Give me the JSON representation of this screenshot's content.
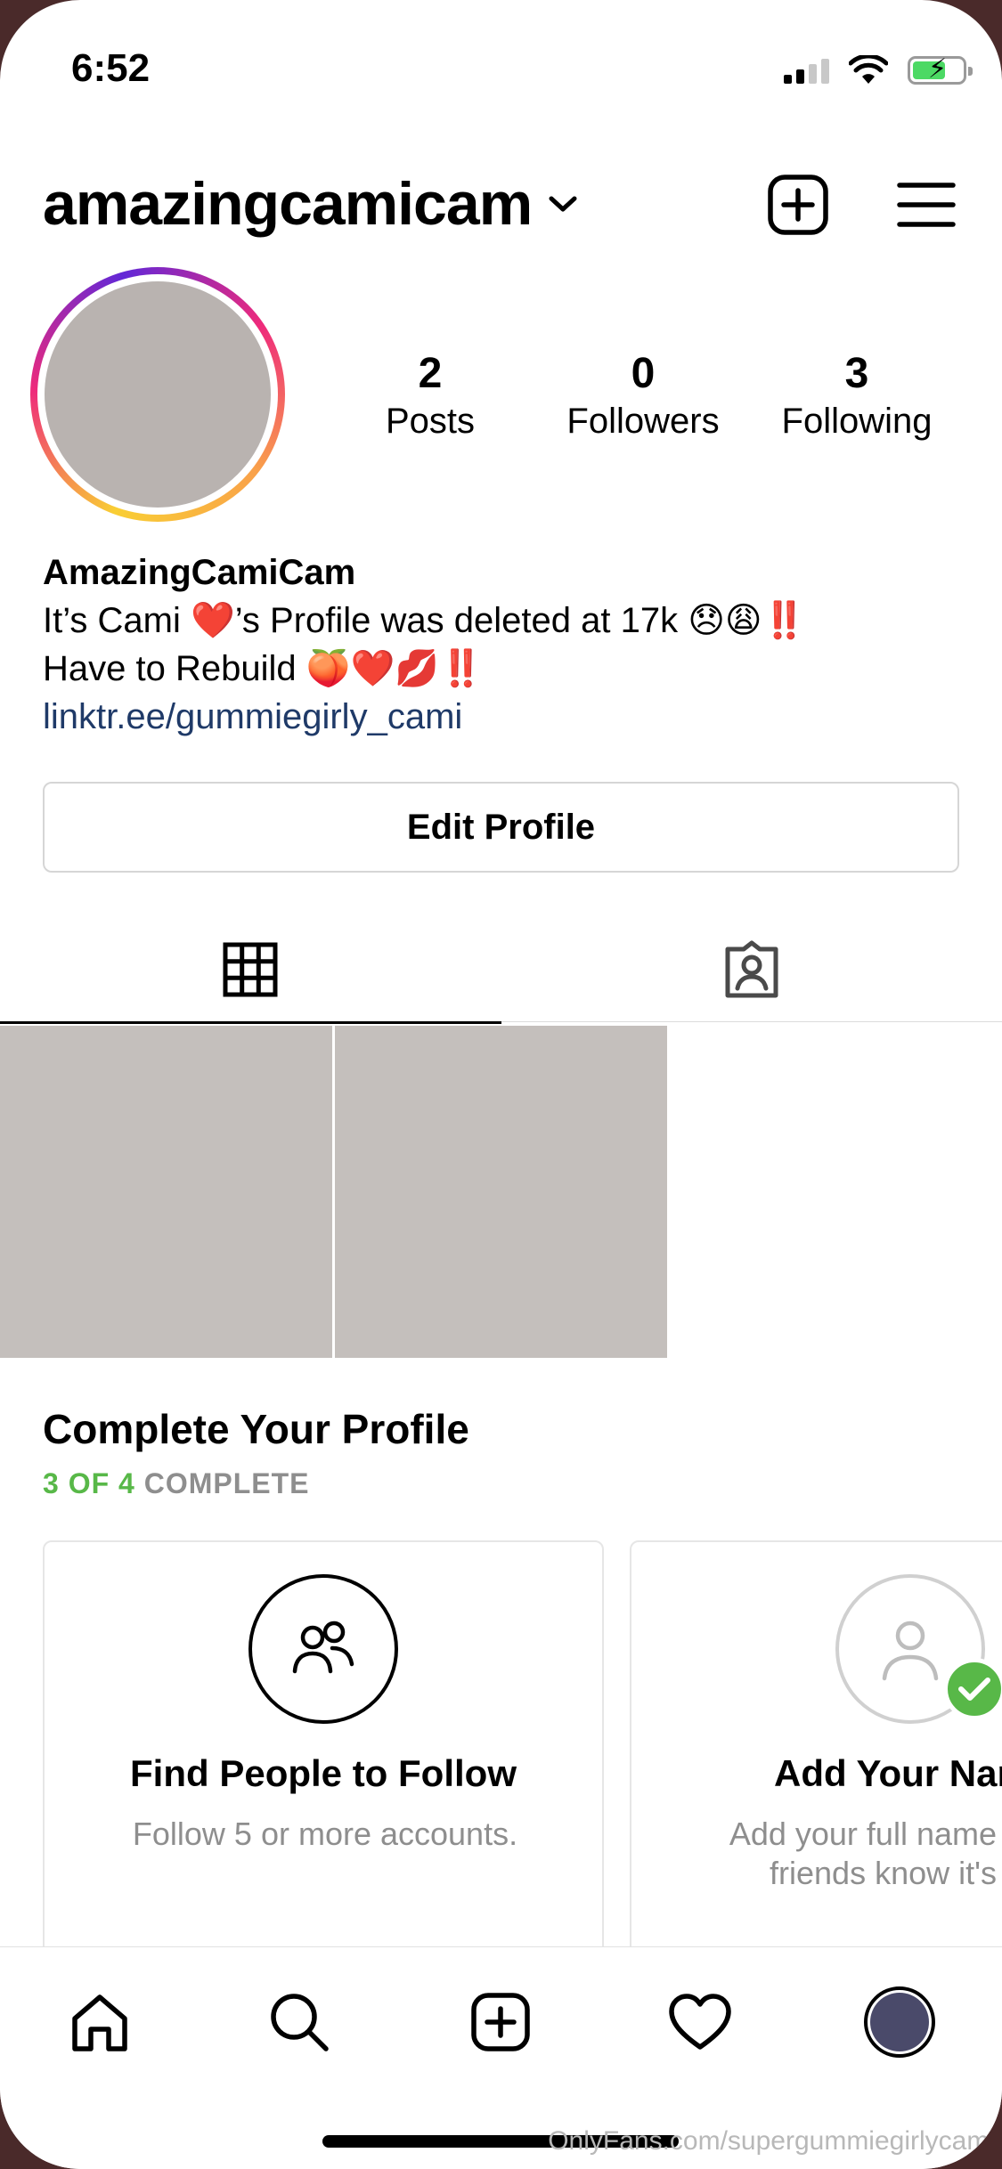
{
  "status_bar": {
    "time": "6:52"
  },
  "header": {
    "username": "amazingcamicam"
  },
  "stats": [
    {
      "num": "2",
      "label": "Posts"
    },
    {
      "num": "0",
      "label": "Followers"
    },
    {
      "num": "3",
      "label": "Following"
    }
  ],
  "bio": {
    "name": "AmazingCamiCam",
    "line1": "It’s Cami ❤️’s Profile was deleted at 17k 😞😩‼️",
    "line2": "Have to Rebuild 🍑❤️💋‼️",
    "link": "linktr.ee/gummiegirly_cami"
  },
  "edit_profile_label": "Edit Profile",
  "complete_profile": {
    "title": "Complete Your Profile",
    "progress_count": "3 OF 4",
    "progress_word": "COMPLETE",
    "cards": [
      {
        "title": "Find People to Follow",
        "subtitle": "Follow 5 or more accounts."
      },
      {
        "title": "Add Your Nar",
        "subtitle": "Add your full name\nfriends know it's"
      }
    ]
  },
  "watermark": "OnlyFans.com/supergummiegirlycami"
}
